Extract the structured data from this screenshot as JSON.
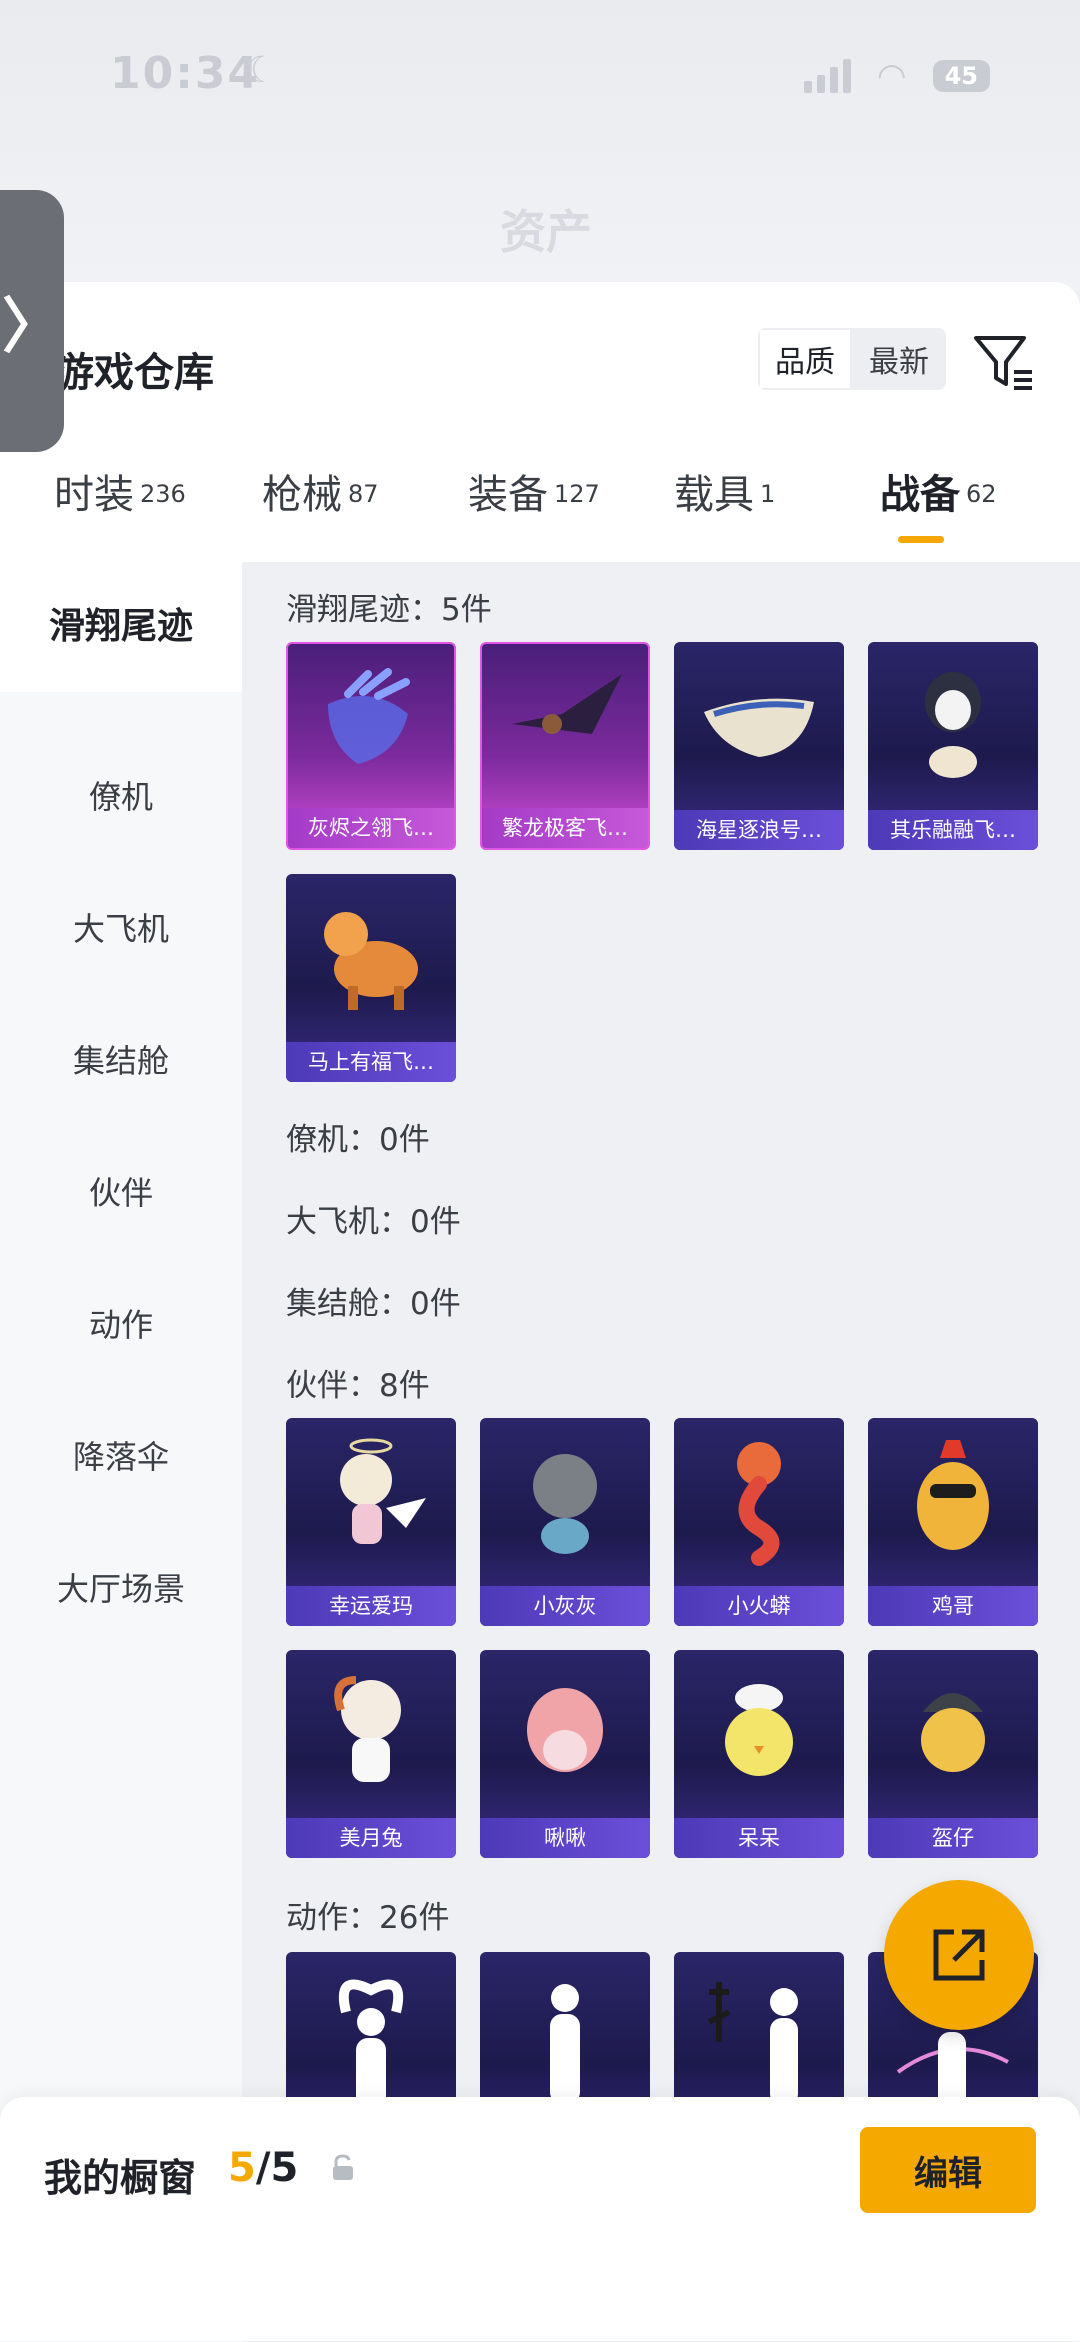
{
  "status_bar": {
    "time": "10:34",
    "battery": "45"
  },
  "header_ghost": {
    "title": "资产"
  },
  "page": {
    "title": "游戏仓库",
    "sort": {
      "quality": "品质",
      "latest": "最新"
    }
  },
  "tabs": [
    {
      "label": "时装",
      "count": "236"
    },
    {
      "label": "枪械",
      "count": "87"
    },
    {
      "label": "装备",
      "count": "127"
    },
    {
      "label": "载具",
      "count": "1"
    },
    {
      "label": "战备",
      "count": "62"
    }
  ],
  "sidebar": {
    "items": [
      "滑翔尾迹",
      "僚机",
      "大飞机",
      "集结舱",
      "伙伴",
      "动作",
      "降落伞",
      "大厅场景"
    ]
  },
  "sections": {
    "trail": {
      "heading": "滑翔尾迹：5件",
      "items": [
        "灰烬之翎飞…",
        "繁龙极客飞…",
        "海星逐浪号…",
        "其乐融融飞…",
        "马上有福飞…"
      ]
    },
    "wingman": {
      "heading": "僚机：0件"
    },
    "plane": {
      "heading": "大飞机：0件"
    },
    "pod": {
      "heading": "集结舱：0件"
    },
    "partner": {
      "heading": "伙伴：8件",
      "items": [
        "幸运爱玛",
        "小灰灰",
        "小火蟒",
        "鸡哥",
        "美月兔",
        "啾啾",
        "呆呆",
        "盔仔"
      ]
    },
    "emote": {
      "heading": "动作：26件"
    }
  },
  "bottom": {
    "showcase_label": "我的橱窗",
    "current": "5",
    "total": "/5",
    "edit": "编辑"
  },
  "colors": {
    "accent": "#f5a800",
    "card_blue": "#2a2668",
    "card_purple": "#7b2a9c"
  }
}
